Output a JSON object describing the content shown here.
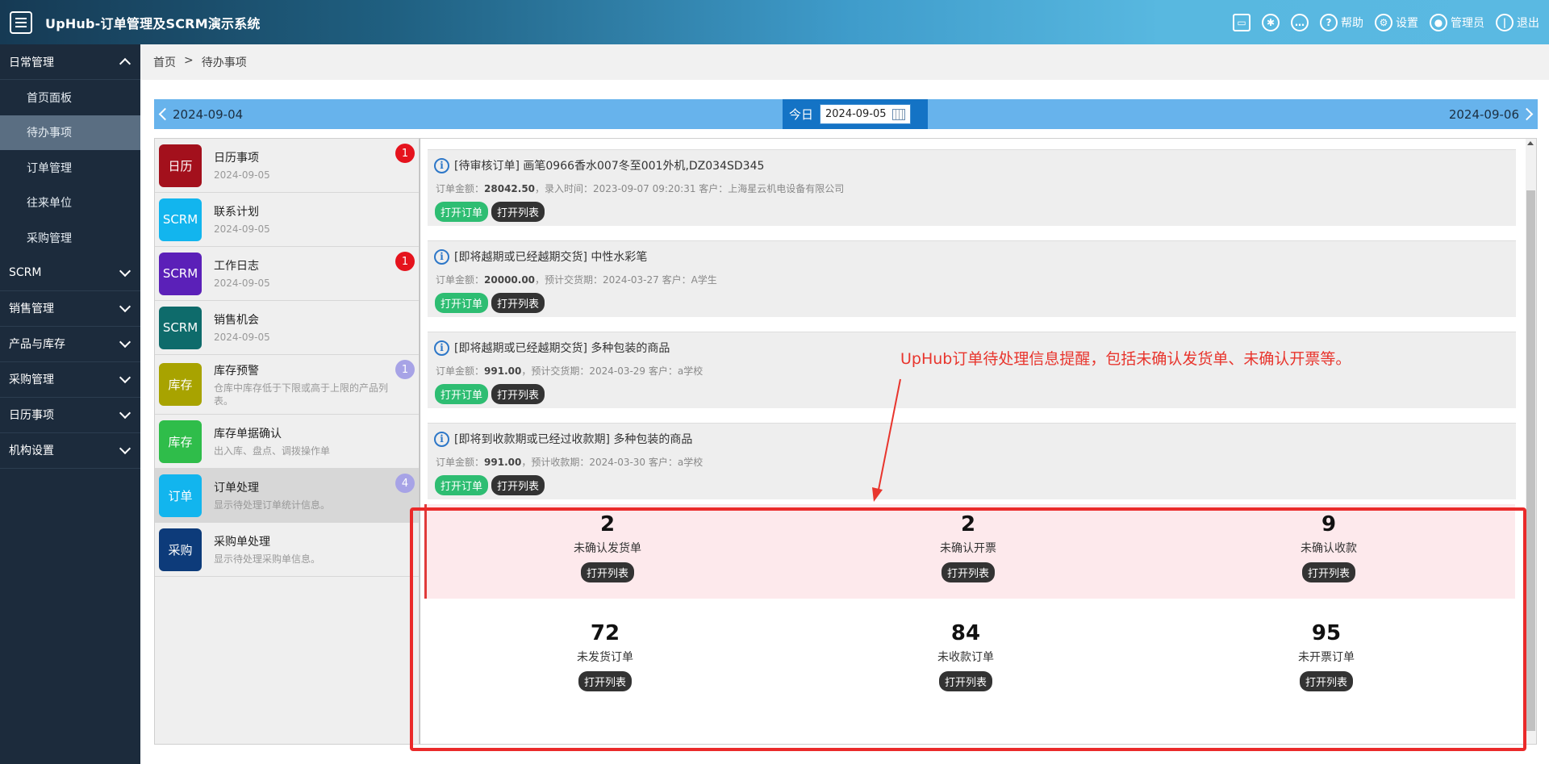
{
  "header": {
    "title": "UpHub-订单管理及SCRM演示系统",
    "actions": [
      {
        "icon": "printer-icon",
        "label": ""
      },
      {
        "icon": "lightbulb-icon",
        "label": ""
      },
      {
        "icon": "chat-icon",
        "label": ""
      },
      {
        "icon": "help-icon",
        "label": "帮助"
      },
      {
        "icon": "gear-icon",
        "label": "设置"
      },
      {
        "icon": "lock-icon",
        "label": "管理员"
      },
      {
        "icon": "power-icon",
        "label": "退出"
      }
    ]
  },
  "sidebar": {
    "groups": [
      {
        "label": "日常管理",
        "expanded": true,
        "items": [
          "首页面板",
          "待办事项",
          "订单管理",
          "往来单位",
          "采购管理"
        ],
        "active_item": "待办事项"
      },
      {
        "label": "SCRM",
        "expanded": false
      },
      {
        "label": "销售管理",
        "expanded": false
      },
      {
        "label": "产品与库存",
        "expanded": false
      },
      {
        "label": "采购管理",
        "expanded": false
      },
      {
        "label": "日历事项",
        "expanded": false
      },
      {
        "label": "机构设置",
        "expanded": false
      }
    ]
  },
  "breadcrumb": {
    "home": "首页",
    "sep": ">",
    "current": "待办事项"
  },
  "datebar": {
    "prev": "2024-09-04",
    "today": "今日",
    "current": "2024-09-05",
    "next": "2024-09-06"
  },
  "left_list": [
    {
      "icon_text": "日历",
      "color": "#a3101c",
      "title": "日历事项",
      "sub": "2024-09-05",
      "badge": "1",
      "badge_color": "#e5131d"
    },
    {
      "icon_text": "SCRM",
      "color": "#12b5ee",
      "title": "联系计划",
      "sub": "2024-09-05",
      "badge": "",
      "badge_color": ""
    },
    {
      "icon_text": "SCRM",
      "color": "#5b20b8",
      "title": "工作日志",
      "sub": "2024-09-05",
      "badge": "1",
      "badge_color": "#e5131d"
    },
    {
      "icon_text": "SCRM",
      "color": "#0e6b6b",
      "title": "销售机会",
      "sub": "2024-09-05",
      "badge": "",
      "badge_color": ""
    },
    {
      "icon_text": "库存",
      "color": "#a8a300",
      "title": "库存预警",
      "sub": "仓库中库存低于下限或高于上限的产品列表。",
      "badge": "1",
      "badge_color": "#a7a3e6"
    },
    {
      "icon_text": "库存",
      "color": "#2fbd4a",
      "title": "库存单据确认",
      "sub": "出入库、盘点、调拨操作单",
      "badge": "",
      "badge_color": ""
    },
    {
      "icon_text": "订单",
      "color": "#12b5ee",
      "title": "订单处理",
      "sub": "显示待处理订单统计信息。",
      "badge": "4",
      "badge_color": "#a7a3e6"
    },
    {
      "icon_text": "采购",
      "color": "#0d3b7a",
      "title": "采购单处理",
      "sub": "显示待处理采购单信息。",
      "badge": "",
      "badge_color": ""
    }
  ],
  "tasks": [
    {
      "title": "[待审核订单] 画笔0966香水007冬至001外机,DZ034SD345",
      "amount_label": "订单金额：",
      "amount": "28042.50",
      "meta": "，录入时间：2023-09-07 09:20:31 客户：上海星云机电设备有限公司",
      "btn_open": "打开订单",
      "btn_list": "打开列表"
    },
    {
      "title": "[即将越期或已经越期交货] 中性水彩笔",
      "amount_label": "订单金额：",
      "amount": "20000.00",
      "meta": "，预计交货期：2024-03-27 客户：A学生",
      "btn_open": "打开订单",
      "btn_list": "打开列表"
    },
    {
      "title": "[即将越期或已经越期交货] 多种包装的商品",
      "amount_label": "订单金额：",
      "amount": "991.00",
      "meta": "，预计交货期：2024-03-29 客户：a学校",
      "btn_open": "打开订单",
      "btn_list": "打开列表"
    },
    {
      "title": "[即将到收款期或已经过收款期] 多种包装的商品",
      "amount_label": "订单金额：",
      "amount": "991.00",
      "meta": "，预计收款期：2024-03-30 客户：a学校",
      "btn_open": "打开订单",
      "btn_list": "打开列表"
    }
  ],
  "stats_row1": [
    {
      "num": "2",
      "label": "未确认发货单",
      "btn": "打开列表"
    },
    {
      "num": "2",
      "label": "未确认开票",
      "btn": "打开列表"
    },
    {
      "num": "9",
      "label": "未确认收款",
      "btn": "打开列表"
    }
  ],
  "stats_row2": [
    {
      "num": "72",
      "label": "未发货订单",
      "btn": "打开列表"
    },
    {
      "num": "84",
      "label": "未收款订单",
      "btn": "打开列表"
    },
    {
      "num": "95",
      "label": "未开票订单",
      "btn": "打开列表"
    }
  ],
  "annotation": {
    "text": "UpHub订单待处理信息提醒，包括未确认发货单、未确认开票等。",
    "color": "#e8352d"
  }
}
